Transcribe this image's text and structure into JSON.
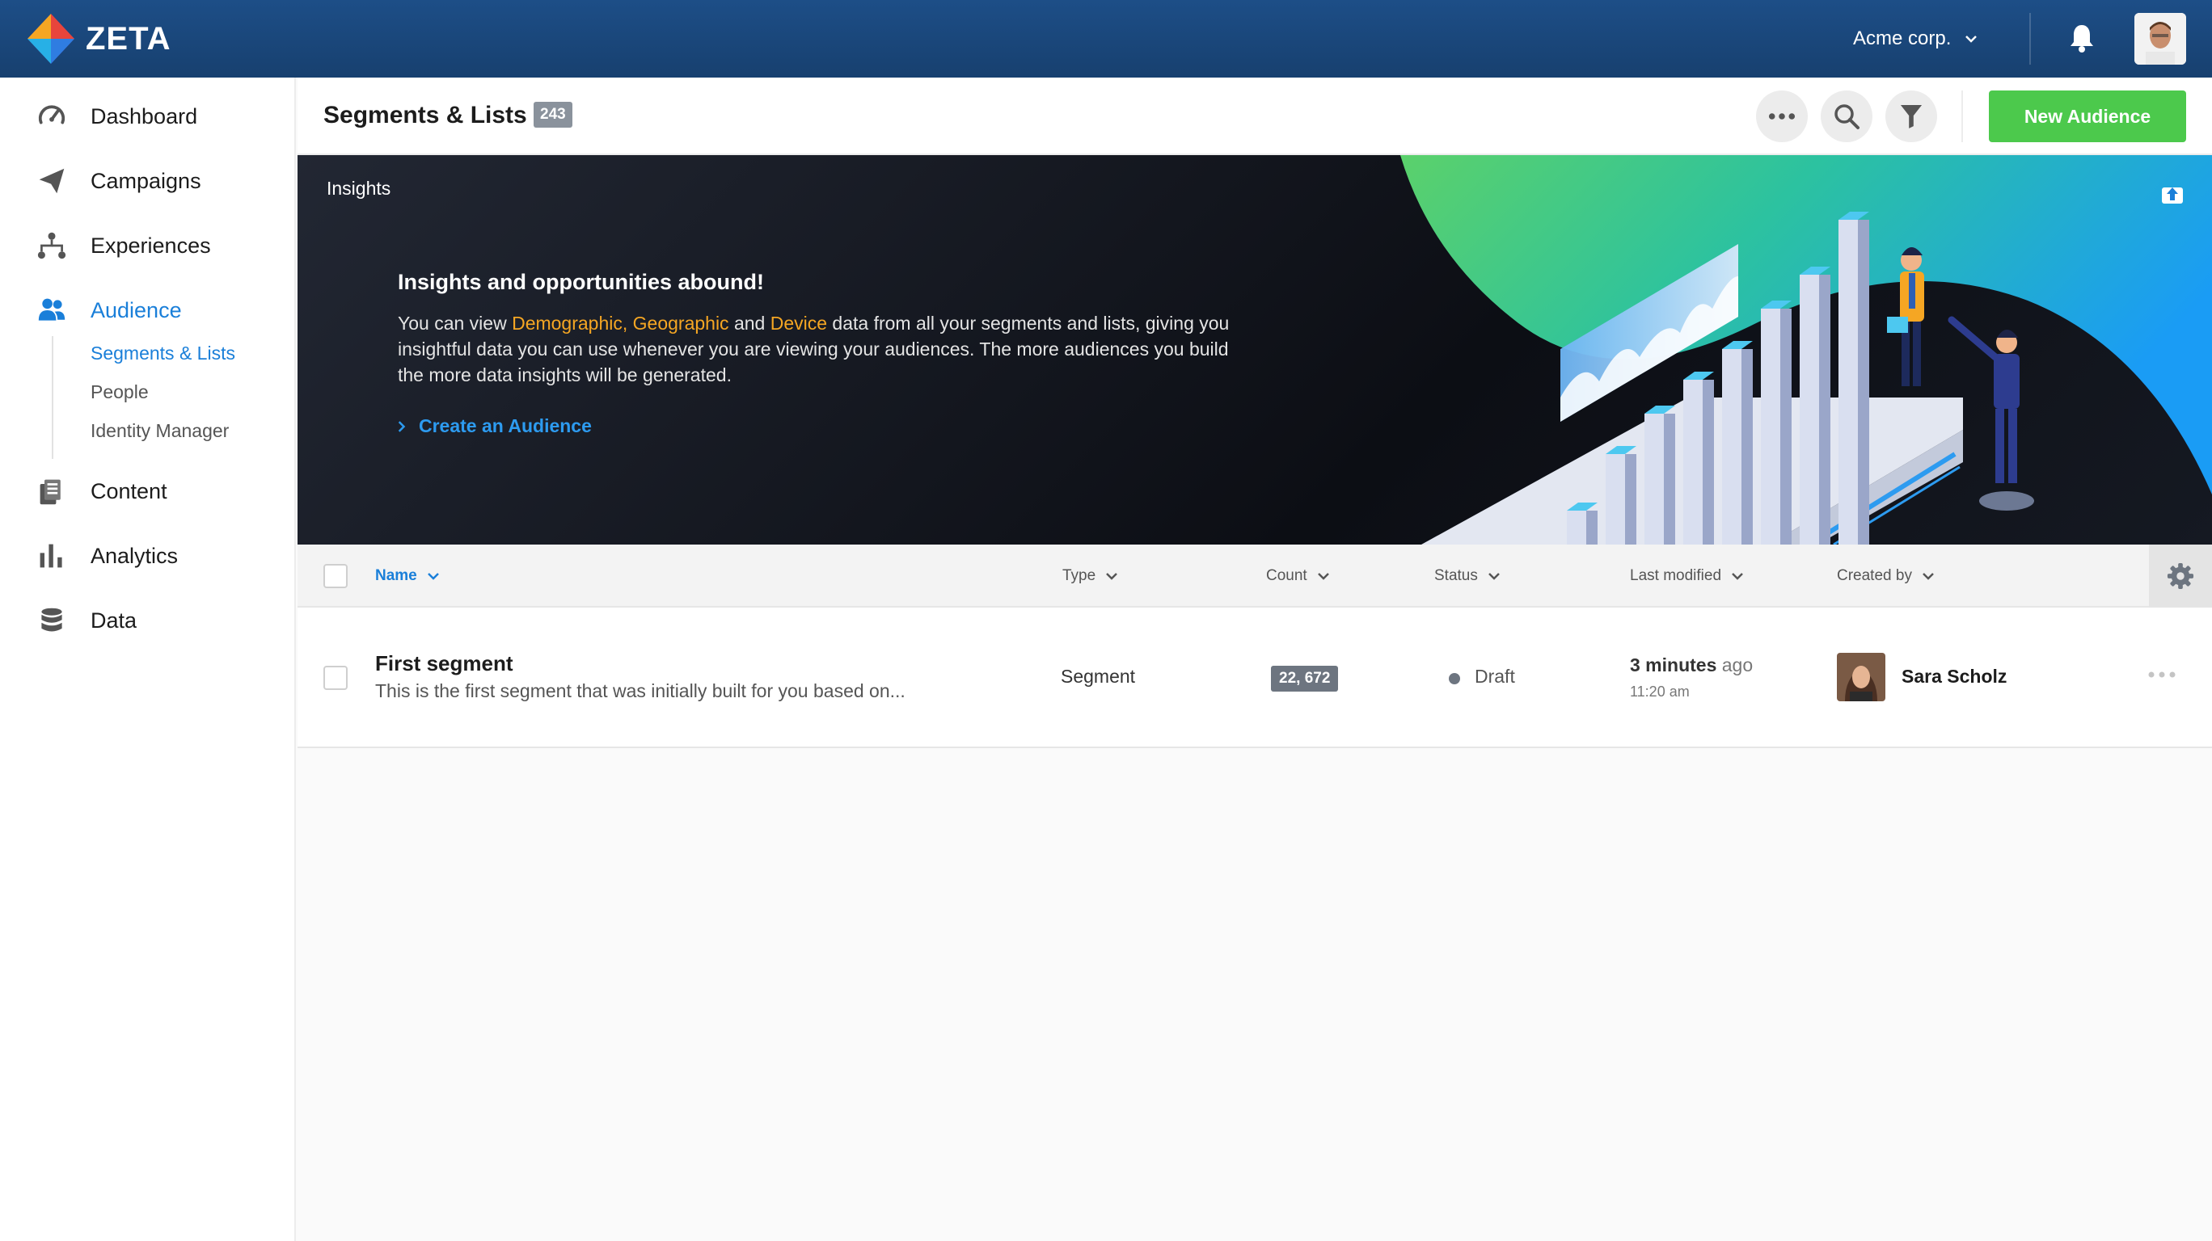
{
  "app": {
    "logo_text": "ZETA",
    "org_name": "Acme corp."
  },
  "sidebar": {
    "items": [
      {
        "label": "Dashboard",
        "icon": "speedometer-icon"
      },
      {
        "label": "Campaigns",
        "icon": "paper-plane-icon"
      },
      {
        "label": "Experiences",
        "icon": "hierarchy-icon"
      },
      {
        "label": "Audience",
        "icon": "users-icon"
      },
      {
        "label": "Content",
        "icon": "documents-icon"
      },
      {
        "label": "Analytics",
        "icon": "bar-chart-icon"
      },
      {
        "label": "Data",
        "icon": "database-icon"
      }
    ],
    "audience_sub": [
      "Segments & Lists",
      "People",
      "Identity Manager"
    ],
    "active_item": "Audience",
    "active_sub": "Segments & Lists"
  },
  "header": {
    "title": "Segments & Lists",
    "count": "243",
    "new_button": "New Audience"
  },
  "insights": {
    "label": "Insights",
    "title": "Insights and opportunities abound!",
    "text_1": "You can view ",
    "hl_1": "Demographic, Geographic",
    "text_2": " and ",
    "hl_2": "Device",
    "text_3": " data from all your segments and lists, giving you insightful data you can use whenever you are viewing your audiences. The more audiences you build the more data insights will be generated.",
    "link": "Create an Audience"
  },
  "table": {
    "columns": {
      "name": "Name",
      "type": "Type",
      "count": "Count",
      "status": "Status",
      "modified": "Last modified",
      "created": "Created by"
    },
    "rows": [
      {
        "name": "First segment",
        "description": "This is the first segment that was initially built for you based on...",
        "type": "Segment",
        "count": "22, 672",
        "status": "Draft",
        "modified_bold": "3 minutes",
        "modified_rest": " ago",
        "modified_time": "11:20  am",
        "creator": "Sara Scholz"
      }
    ]
  },
  "colors": {
    "topbar": "#1d4e87",
    "accent": "#1a7fd9",
    "primary_button": "#4cc94c",
    "highlight": "#f5a623"
  }
}
